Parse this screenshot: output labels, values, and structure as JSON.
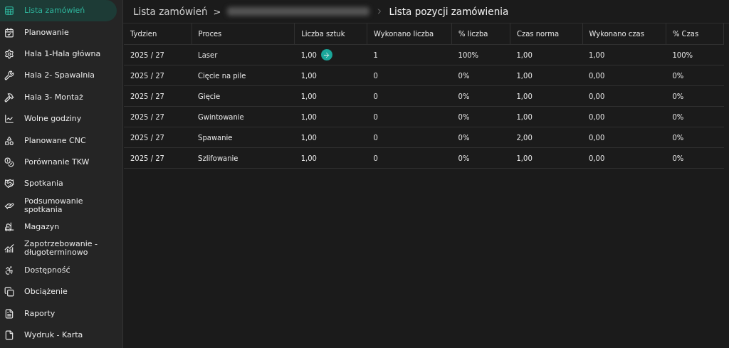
{
  "sidebar": {
    "items": [
      {
        "label": "Lista zamówień",
        "selected": true
      },
      {
        "label": "Planowanie",
        "selected": false
      },
      {
        "label": "Hala 1-Hala główna",
        "selected": false
      },
      {
        "label": "Hala 2- Spawalnia",
        "selected": false
      },
      {
        "label": "Hala 3- Montaż",
        "selected": false
      },
      {
        "label": "Wolne godziny",
        "selected": false
      },
      {
        "label": "Planowane CNC",
        "selected": false
      },
      {
        "label": "Porównanie TKW",
        "selected": false
      },
      {
        "label": "Spotkania",
        "selected": false
      },
      {
        "label": "Podsumowanie spotkania",
        "selected": false
      },
      {
        "label": "Magazyn",
        "selected": false
      },
      {
        "label": "Zapotrzebowanie - długoterminowo",
        "selected": false
      },
      {
        "label": "Dostępność",
        "selected": false
      },
      {
        "label": "Obciążenie",
        "selected": false
      },
      {
        "label": "Raporty",
        "selected": false
      },
      {
        "label": "Wydruk - Karta",
        "selected": false
      }
    ]
  },
  "breadcrumb": {
    "root": "Lista zamówień",
    "separator": ">",
    "current": "Lista pozycji zamówienia"
  },
  "table": {
    "columns": [
      "Tydzien",
      "Proces",
      "Liczba sztuk",
      "Wykonano liczba",
      "% liczba",
      "Czas norma",
      "Wykonano czas",
      "% Czas"
    ],
    "rows": [
      {
        "cells": [
          "2025 / 27",
          "Laser",
          "1,00",
          "1",
          "100%",
          "1,00",
          "1,00",
          "100%"
        ],
        "action_button": true
      },
      {
        "cells": [
          "2025 / 27",
          "Cięcie na pile",
          "1,00",
          "0",
          "0%",
          "1,00",
          "0,00",
          "0%"
        ],
        "action_button": false
      },
      {
        "cells": [
          "2025 / 27",
          "Gięcie",
          "1,00",
          "0",
          "0%",
          "1,00",
          "0,00",
          "0%"
        ],
        "action_button": false
      },
      {
        "cells": [
          "2025 / 27",
          "Gwintowanie",
          "1,00",
          "0",
          "0%",
          "1,00",
          "0,00",
          "0%"
        ],
        "action_button": false
      },
      {
        "cells": [
          "2025 / 27",
          "Spawanie",
          "1,00",
          "0",
          "0%",
          "2,00",
          "0,00",
          "0%"
        ],
        "action_button": false
      },
      {
        "cells": [
          "2025 / 27",
          "Szlifowanie",
          "1,00",
          "0",
          "0%",
          "1,00",
          "0,00",
          "0%"
        ],
        "action_button": false
      }
    ]
  }
}
